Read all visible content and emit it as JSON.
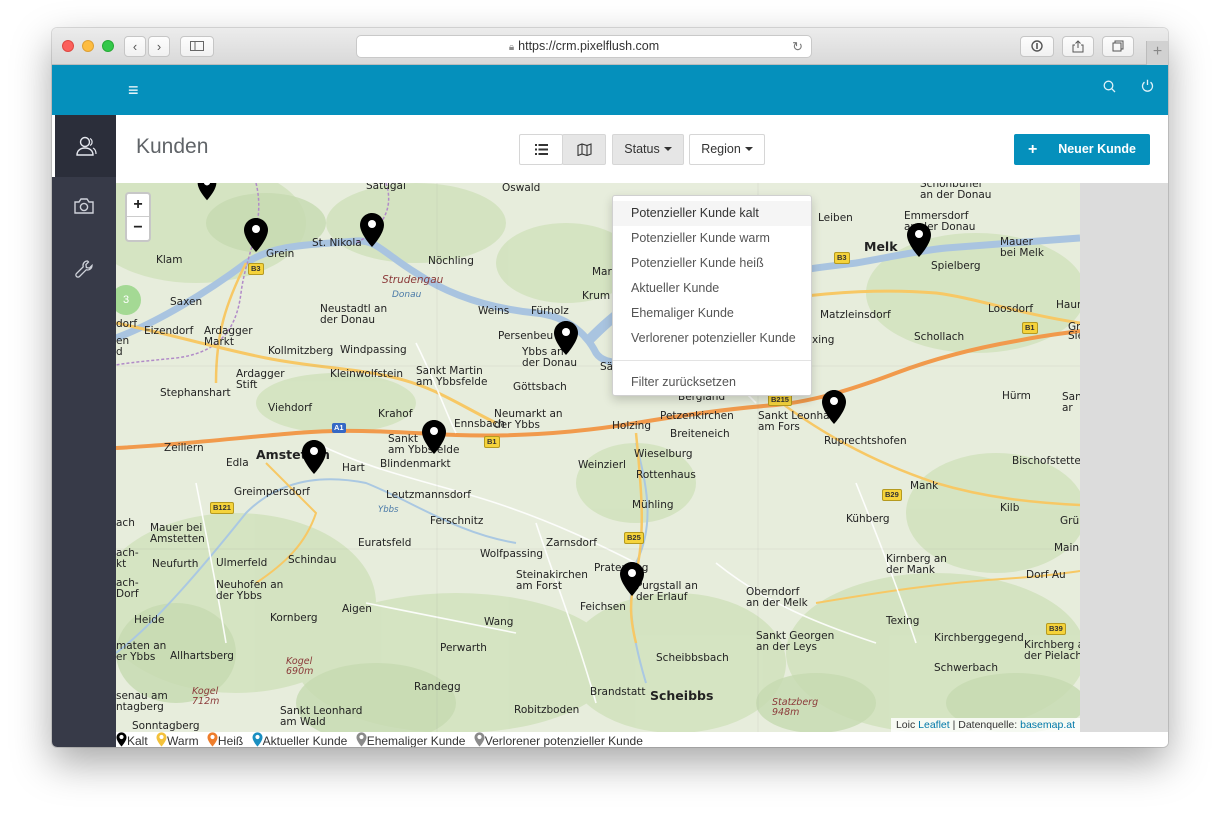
{
  "browser": {
    "url": "https://crm.pixelflush.com"
  },
  "page": {
    "title": "Kunden",
    "status_label": "Status",
    "region_label": "Region",
    "new_customer_label": "Neuer Kunde"
  },
  "status_menu": {
    "items": [
      "Potenzieller Kunde kalt",
      "Potenzieller Kunde warm",
      "Potenzieller Kunde heiß",
      "Aktueller Kunde",
      "Ehemaliger Kunde",
      "Verlorener potenzieller Kunde"
    ],
    "reset": "Filter zurücksetzen"
  },
  "map": {
    "zoom_in": "+",
    "zoom_out": "−",
    "cluster_count": "3",
    "attribution_prefix": "Loic",
    "attribution_leaflet": "Leaflet",
    "attribution_source": " | Datenquelle: ",
    "attribution_basemap": "basemap.at"
  },
  "legend": {
    "items": [
      {
        "label": "Kalt",
        "color": "#000000"
      },
      {
        "label": "Warm",
        "color": "#f3c13a"
      },
      {
        "label": "Heiß",
        "color": "#ee7d2b"
      },
      {
        "label": "Aktueller Kunde",
        "color": "#1a8fc1"
      },
      {
        "label": "Ehemaliger Kunde",
        "color": "#8a8a8a"
      },
      {
        "label": "Verlorener potenzieller Kunde",
        "color": "#8a8a8a"
      }
    ]
  },
  "places": {
    "satugal": "Saťugal",
    "oswald": "Oswald",
    "schonbuhel": "Schönbühel\nan der Donau",
    "leiben": "Leiben",
    "emmersdorf": "Emmersdorf\nan der Donau",
    "klam": "Klam",
    "grein": "Grein",
    "stnikola": "St. Nikola",
    "nochling": "Nöchling",
    "marbach": "Marb",
    "krum": "Krum",
    "melk": "Melk",
    "mauer": "Mauer\nbei Melk",
    "spielberg": "Spielberg",
    "strudengau": "Strudengau",
    "donau": "Donau",
    "saxen": "Saxen",
    "neustadtl": "Neustadtl an\nder Donau",
    "weins": "Weins",
    "furholz": "Fürholz",
    "persenbeug": "Persenbeu",
    "ybbs": "Ybbs an\nder Donau",
    "matzleinsdorf": "Matzleinsdorf",
    "loosdorf": "Loosdorf",
    "haun": "Haun",
    "gr": "Gr",
    "sie": "Sie",
    "schollach": "Schollach",
    "dorf": "dorf",
    "eizendorf": "Eizendorf",
    "ardagger": "Ardagger\nMarkt",
    "en": "en\nd",
    "kollmitzberg": "Kollmitzberg",
    "windpassing": "Windpassing",
    "ardaggerstift": "Ardagger\nStift",
    "kleinwolfstein": "Kleinwolfstein",
    "sanktmartin": "Sankt Martin\nam Ybbsfelde",
    "gottsbach": "Göttsbach",
    "sailing": "Säling",
    "xing": "xing",
    "stephanshart": "Stephanshart",
    "viehdorf": "Viehdorf",
    "krahof": "Krahof",
    "ennsbach": "Ennsbach",
    "neumarkt": "Neumarkt an\nder Ybbs",
    "holzing": "Holzing",
    "bergland": "Bergland",
    "petzenkirchen": "Petzenkirchen",
    "breiteneich": "Breiteneich",
    "sanktleonhard": "Sankt Leonha\nam Fors",
    "ruprechtshofen": "Ruprechtshofen",
    "hurm": "Hürm",
    "sanar": "San\nar",
    "zeillern": "Zeillern",
    "amstetten": "Amstetten",
    "edla": "Edla",
    "hart": "Hart",
    "sanktgeorgen_ybbs": "Sankt\nam Ybbsfelde",
    "blindenmarkt": "Blindenmarkt",
    "weinzierl": "Weinzierl",
    "wieselburg": "Wieselburg",
    "rottenhaus": "Rottenhaus",
    "bischofstetten": "Bischofstetten",
    "mank": "Mank",
    "greimpersdorf": "Greimpersdorf",
    "leutzmannsdorf": "Leutzmannsdorf",
    "muhling": "Mühling",
    "kilb": "Kilb",
    "ach": "ach",
    "mauerbei": "Mauer bei\nAmstetten",
    "ferschnitz": "Ferschnitz",
    "kuhberg": "Kühberg",
    "grun": "Grün",
    "mainb": "Mainb",
    "euratsfeld": "Euratsfeld",
    "zarnsdorf": "Zarnsdorf",
    "ach2": "ach-\nkt",
    "neufurth": "Neufurth",
    "ulmerfeld": "Ulmerfeld",
    "schindau": "Schindau",
    "wolfpassing": "Wolfpassing",
    "prateraing": "Prateraing",
    "kirnberg": "Kirnberg an\nder Mank",
    "dorfau": "Dorf Au",
    "achdorf": "ach-\nDorf",
    "neuhofen": "Neuhofen an\nder Ybbs",
    "steinakirchen": "Steinakirchen\nam Forst",
    "purgstall": "Purgstall an\nder Erlauf",
    "feichsen": "Feichsen",
    "oberndorf": "Oberndorf\nan der Melk",
    "heide": "Heide",
    "kornberg": "Kornberg",
    "aigen": "Aigen",
    "wang": "Wang",
    "texing": "Texing",
    "sanktgeorgen_leys": "Sankt Georgen\nan der Leys",
    "kirchberggegend": "Kirchberggegend",
    "kirchbergpielach": "Kirchberg a\nder Pielach",
    "maten": "maten an\ner Ybbs",
    "allhartsberg": "Allhartsberg",
    "kogel1": "Kogel\n690m",
    "perwarth": "Perwarth",
    "scheibbsbach": "Scheibbsbach",
    "schwerbach": "Schwerbach",
    "randegg": "Randegg",
    "brandstatt": "Brandstatt",
    "scheibbs": "Scheibbs",
    "statzberg": "Statzberg\n948m",
    "senau": "senau am\nntagberg",
    "kogel2": "Kogel\n712m",
    "sanktleonhardwald": "Sankt Leonhard\nam Wald",
    "robitzboden": "Robitzboden",
    "sonntagberg": "Sonntagberg",
    "ybbs_river": "Ybbs"
  },
  "roads": {
    "b3a": "B3",
    "b3b": "B3",
    "b1a": "B1",
    "b1b": "B1",
    "b1c": "B1",
    "a1": "A1",
    "b215": "B215",
    "b29": "B29",
    "b25": "B25",
    "b121": "B121",
    "b39": "B39"
  }
}
